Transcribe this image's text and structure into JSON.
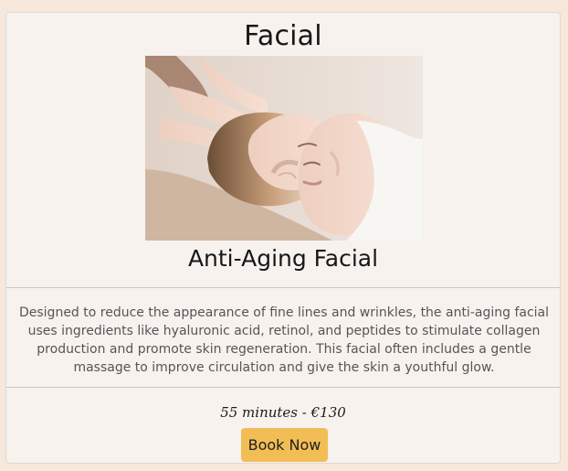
{
  "service": {
    "category_title": "Facial",
    "image_alt": "Woman receiving a facial massage",
    "name": "Anti-Aging Facial",
    "description": "Designed to reduce the appearance of fine lines and wrinkles, the anti-aging facial uses ingredients like hyaluronic acid, retinol, and peptides to stimulate collagen production and promote skin regeneration. This facial often includes a gentle massage to improve circulation and give the skin a youthful glow.",
    "duration_price": "55 minutes - €130",
    "book_label": "Book Now"
  },
  "colors": {
    "page_background": "#f8e8dc",
    "card_background": "#f8f2ef",
    "button_background": "#f2bd55",
    "title_text": "#171717",
    "body_text": "#555555"
  }
}
